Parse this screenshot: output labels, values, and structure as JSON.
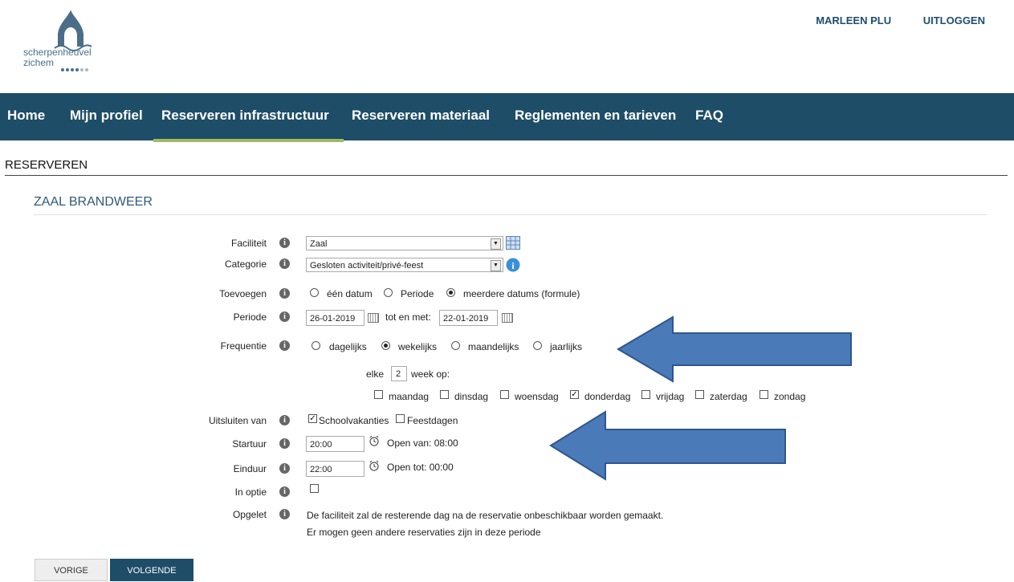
{
  "logo": {
    "line1": "scherpenheuvel",
    "line2": "zichem"
  },
  "user_menu": {
    "user": "MARLEEN PLU",
    "logout": "UITLOGGEN"
  },
  "nav": {
    "home": "Home",
    "profile": "Mijn profiel",
    "infra": "Reserveren infrastructuur",
    "material": "Reserveren materiaal",
    "rules": "Reglementen en tarieven",
    "faq": "FAQ"
  },
  "page": {
    "title": "RESERVEREN",
    "subtitle": "ZAAL BRANDWEER"
  },
  "form": {
    "faciliteit": {
      "label": "Faciliteit",
      "value": "Zaal"
    },
    "categorie": {
      "label": "Categorie",
      "value": "Gesloten activiteit/privé-feest"
    },
    "toevoegen": {
      "label": "Toevoegen",
      "opt1": "één datum",
      "opt2": "Periode",
      "opt3": "meerdere datums (formule)",
      "selected": "meerdere datums (formule)"
    },
    "periode": {
      "label": "Periode",
      "from": "26-01-2019",
      "to_label": "tot en met:",
      "to": "22-01-2019"
    },
    "frequentie": {
      "label": "Frequentie",
      "opt1": "dagelijks",
      "opt2": "wekelijks",
      "opt3": "maandelijks",
      "opt4": "jaarlijks",
      "selected": "wekelijks"
    },
    "elke": {
      "prefix": "elke",
      "value": "2",
      "suffix": "week op:"
    },
    "days": {
      "d1": "maandag",
      "d2": "dinsdag",
      "d3": "woensdag",
      "d4": "donderdag",
      "d5": "vrijdag",
      "d6": "zaterdag",
      "d7": "zondag",
      "checked": "donderdag"
    },
    "uitsluiten": {
      "label": "Uitsluiten van",
      "opt1": "Schoolvakanties",
      "opt2": "Feestdagen"
    },
    "startuur": {
      "label": "Startuur",
      "value": "20:00",
      "note": "Open van: 08:00"
    },
    "einduur": {
      "label": "Einduur",
      "value": "22:00",
      "note": "Open tot: 00:00"
    },
    "optie": {
      "label": "In optie"
    },
    "opgelet": {
      "label": "Opgelet",
      "line1": "De faciliteit zal de resterende dag na de reservatie onbeschikbaar worden gemaakt.",
      "line2": "Er mogen geen andere reservaties zijn in deze periode"
    }
  },
  "buttons": {
    "prev": "VORIGE",
    "next": "VOLGENDE"
  },
  "colors": {
    "nav_bg": "#1e4d68",
    "nav_underline": "#a4b964",
    "arrow": "#4a7ab8"
  }
}
